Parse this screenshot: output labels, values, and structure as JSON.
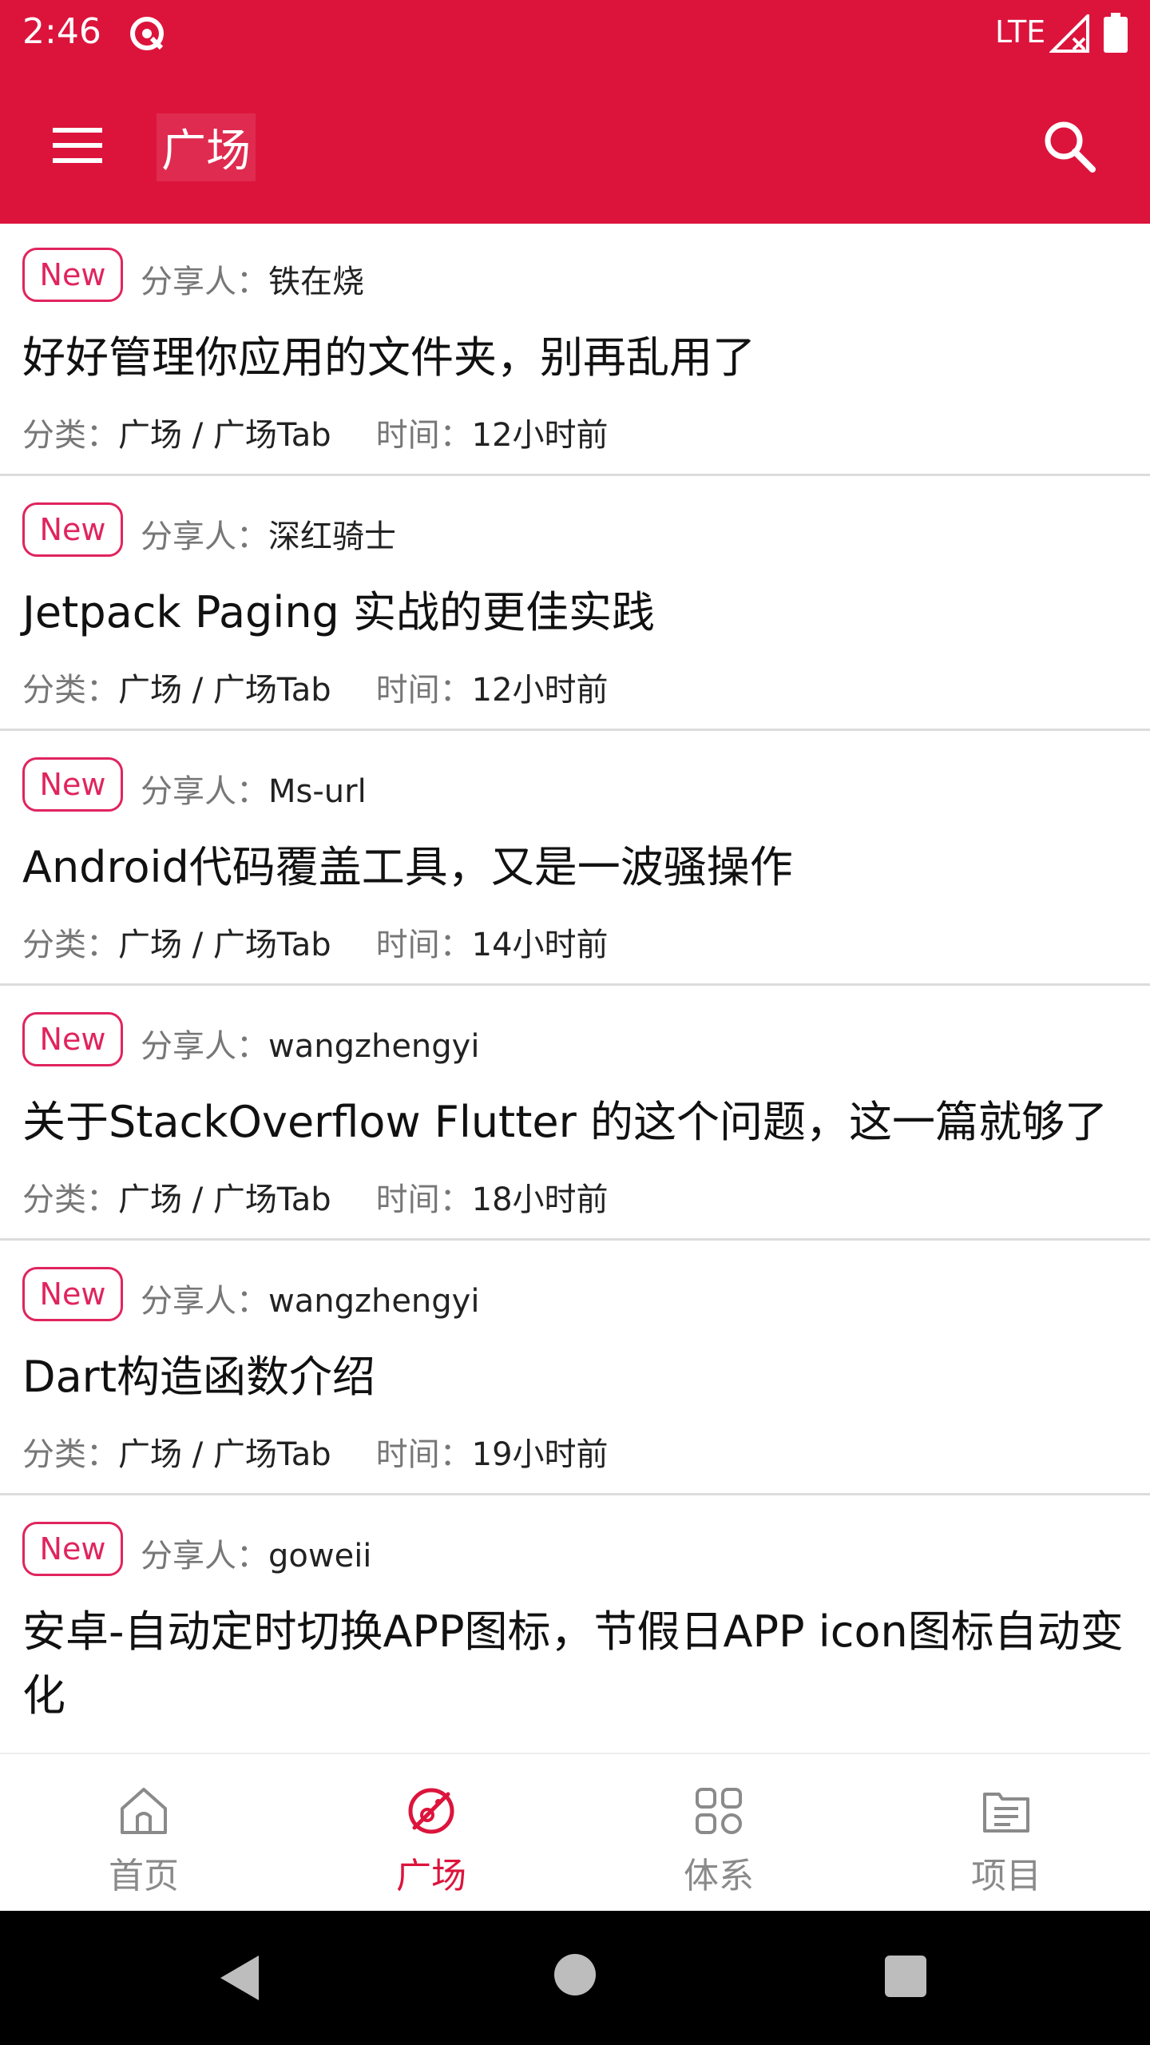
{
  "status_bar": {
    "time": "2:46",
    "network": "LTE"
  },
  "app_bar": {
    "title": "广场"
  },
  "labels": {
    "sharer": "分享人：",
    "category": "分类：",
    "time": "时间：",
    "badge": "New"
  },
  "articles": [
    {
      "sharer": "铁在烧",
      "title": "好好管理你应用的文件夹，别再乱用了",
      "category": "广场 / 广场Tab",
      "time": "12小时前"
    },
    {
      "sharer": "深红骑士",
      "title": "Jetpack Paging 实战的更佳实践",
      "category": "广场 / 广场Tab",
      "time": "12小时前"
    },
    {
      "sharer": "Ms-url",
      "title": "Android代码覆盖工具，又是一波骚操作",
      "category": "广场 / 广场Tab",
      "time": "14小时前"
    },
    {
      "sharer": "wangzhengyi",
      "title": "关于StackOverflow Flutter 的这个问题，这一篇就够了",
      "category": "广场 / 广场Tab",
      "time": "18小时前"
    },
    {
      "sharer": "wangzhengyi",
      "title": "Dart构造函数介绍",
      "category": "广场 / 广场Tab",
      "time": "19小时前"
    },
    {
      "sharer": "goweii",
      "title": "安卓-自动定时切换APP图标，节假日APP icon图标自动变化",
      "category": "",
      "time": ""
    }
  ],
  "bottom_nav": [
    {
      "label": "首页",
      "icon": "home-icon"
    },
    {
      "label": "广场",
      "icon": "square-icon"
    },
    {
      "label": "体系",
      "icon": "system-icon"
    },
    {
      "label": "项目",
      "icon": "project-icon"
    }
  ],
  "colors": {
    "primary": "#dc143c",
    "badge": "#e0245e",
    "inactive_nav": "#8a8a8a"
  }
}
